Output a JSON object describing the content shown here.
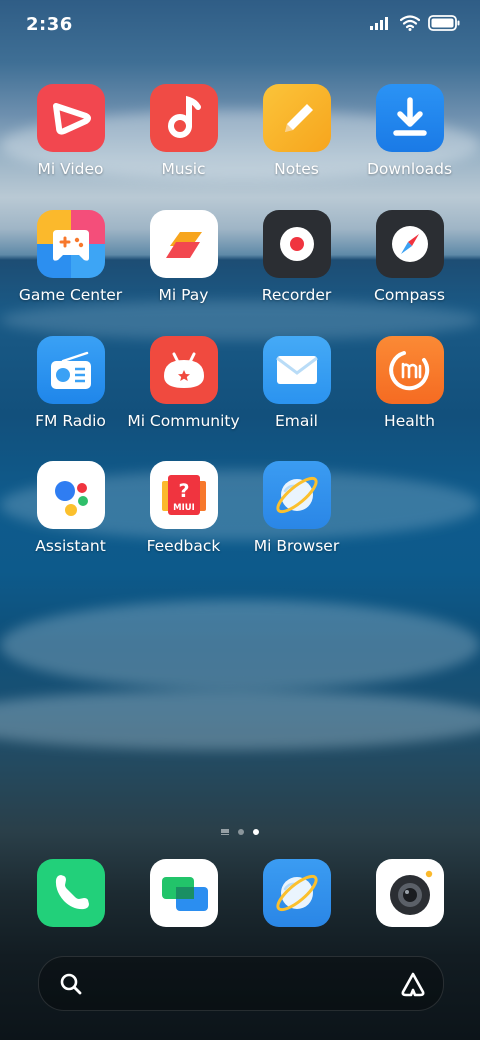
{
  "status_bar": {
    "time": "2:36",
    "icons": [
      "signal-icon",
      "wifi-icon",
      "battery-icon"
    ]
  },
  "home_apps": [
    {
      "label": "Mi Video",
      "icon": "mi-video-icon"
    },
    {
      "label": "Music",
      "icon": "music-icon"
    },
    {
      "label": "Notes",
      "icon": "notes-icon"
    },
    {
      "label": "Downloads",
      "icon": "downloads-icon"
    },
    {
      "label": "Game Center",
      "icon": "game-center-icon"
    },
    {
      "label": "Mi Pay",
      "icon": "mi-pay-icon"
    },
    {
      "label": "Recorder",
      "icon": "recorder-icon"
    },
    {
      "label": "Compass",
      "icon": "compass-icon"
    },
    {
      "label": "FM Radio",
      "icon": "fm-radio-icon"
    },
    {
      "label": "Mi Community",
      "icon": "mi-community-icon"
    },
    {
      "label": "Email",
      "icon": "email-icon"
    },
    {
      "label": "Health",
      "icon": "health-icon"
    },
    {
      "label": "Assistant",
      "icon": "assistant-icon"
    },
    {
      "label": "Feedback",
      "icon": "feedback-icon",
      "badge_text": "MIUI"
    },
    {
      "label": "Mi Browser",
      "icon": "mi-browser-icon"
    }
  ],
  "page_indicator": {
    "pages": 2,
    "current": 2
  },
  "dock": [
    {
      "icon": "phone-icon"
    },
    {
      "icon": "messages-icon"
    },
    {
      "icon": "browser-icon"
    },
    {
      "icon": "camera-icon"
    }
  ],
  "search_bar": {
    "left_icon": "search-icon",
    "right_icon": "assistant-a-icon"
  },
  "colors": {
    "mi_video": "#f2474f",
    "music": "#f04b45",
    "notes": "#fbb92c",
    "downloads": "#2187f0",
    "recorder": "#2b2e33",
    "email": "#3ba1f2",
    "health": "#f7782c",
    "browser": "#2a8ae8",
    "phone": "#22d07a"
  }
}
